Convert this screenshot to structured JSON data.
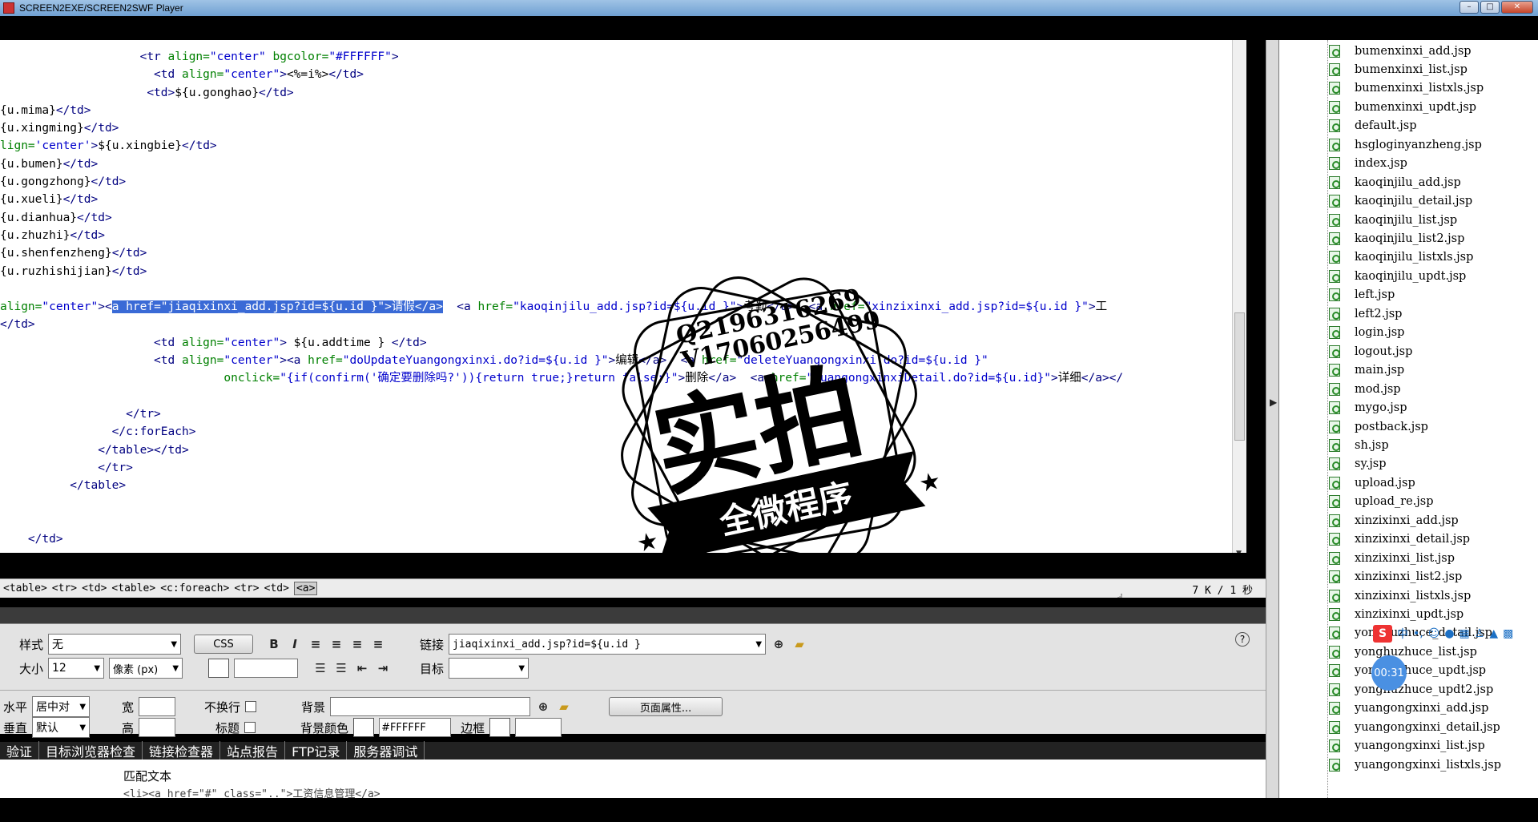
{
  "window": {
    "title": "SCREEN2EXE/SCREEN2SWF Player",
    "buttons": [
      "–",
      "□",
      "✕"
    ]
  },
  "code_lines": [
    [
      [
        "tag",
        "                    <tr "
      ],
      [
        "at",
        "align="
      ],
      [
        "str",
        "\"center\""
      ],
      [
        "at",
        " bgcolor="
      ],
      [
        "str",
        "\"#FFFFFF\""
      ],
      [
        "tag",
        ">"
      ]
    ],
    [
      [
        "tag",
        "                      <td "
      ],
      [
        "at",
        "align="
      ],
      [
        "str",
        "\"center\""
      ],
      [
        "tag",
        ">"
      ],
      [
        "tx",
        "<%=i%>"
      ],
      [
        "tag",
        "</td>"
      ]
    ],
    [
      [
        "tag",
        "                     <td>"
      ],
      [
        "tx",
        "${u.gonghao}"
      ],
      [
        "tag",
        "</td>"
      ]
    ],
    [
      [
        "tx",
        "{u.mima}"
      ],
      [
        "tag",
        "</td>"
      ]
    ],
    [
      [
        "tx",
        "{u.xingming}"
      ],
      [
        "tag",
        "</td>"
      ]
    ],
    [
      [
        "at",
        "lign="
      ],
      [
        "str",
        "'center'"
      ],
      [
        "tag",
        ">"
      ],
      [
        "tx",
        "${u.xingbie}"
      ],
      [
        "tag",
        "</td>"
      ]
    ],
    [
      [
        "tx",
        "{u.bumen}"
      ],
      [
        "tag",
        "</td>"
      ]
    ],
    [
      [
        "tx",
        "{u.gongzhong}"
      ],
      [
        "tag",
        "</td>"
      ]
    ],
    [
      [
        "tx",
        "{u.xueli}"
      ],
      [
        "tag",
        "</td>"
      ]
    ],
    [
      [
        "tx",
        "{u.dianhua}"
      ],
      [
        "tag",
        "</td>"
      ]
    ],
    [
      [
        "tx",
        "{u.zhuzhi}"
      ],
      [
        "tag",
        "</td>"
      ]
    ],
    [
      [
        "tx",
        "{u.shenfenzheng}"
      ],
      [
        "tag",
        "</td>"
      ]
    ],
    [
      [
        "tx",
        "{u.ruzhishijian}"
      ],
      [
        "tag",
        "</td>"
      ]
    ],
    [
      [
        "tx",
        ""
      ]
    ],
    [
      [
        "at",
        "align="
      ],
      [
        "str",
        "\"center\""
      ],
      [
        "tag",
        "><"
      ],
      [
        "sel",
        "a href=\"jiaqixinxi_add.jsp?id=${u.id }\">请假</a>"
      ],
      [
        "tx",
        "  "
      ],
      [
        "tag",
        "<a "
      ],
      [
        "at",
        "href="
      ],
      [
        "str",
        "\"kaoqinjilu_add.jsp?id=${u.id }\""
      ],
      [
        "tag",
        ">"
      ],
      [
        "tx",
        "考勤"
      ],
      [
        "tag",
        "</a>  <a "
      ],
      [
        "at",
        "href="
      ],
      [
        "str",
        "\"xinzixinxi_add.jsp?id=${u.id }\""
      ],
      [
        "tag",
        ">"
      ],
      [
        "tx",
        "工"
      ]
    ],
    [
      [
        "tag",
        "</td>"
      ]
    ],
    [
      [
        "tag",
        "                      <td "
      ],
      [
        "at",
        "align="
      ],
      [
        "str",
        "\"center\""
      ],
      [
        "tag",
        ">"
      ],
      [
        "tx",
        " ${u.addtime } "
      ],
      [
        "tag",
        "</td>"
      ]
    ],
    [
      [
        "tag",
        "                      <td "
      ],
      [
        "at",
        "align="
      ],
      [
        "str",
        "\"center\""
      ],
      [
        "tag",
        "><a "
      ],
      [
        "at",
        "href="
      ],
      [
        "str",
        "\"doUpdateYuangongxinxi.do?id=${u.id }\""
      ],
      [
        "tag",
        ">"
      ],
      [
        "tx",
        "编辑"
      ],
      [
        "tag",
        "</a>  <a "
      ],
      [
        "at",
        "href="
      ],
      [
        "str",
        "\"deleteYuangongxinxi.do?id=${u.id }\""
      ]
    ],
    [
      [
        "tx",
        "                                "
      ],
      [
        "at",
        "onclick="
      ],
      [
        "str",
        "\"{if(confirm('确定要删除吗?')){return true;}return false;}\""
      ],
      [
        "tag",
        ">"
      ],
      [
        "tx",
        "删除"
      ],
      [
        "tag",
        "</a>  <a "
      ],
      [
        "at",
        "href="
      ],
      [
        "str",
        "\"yuangongxinxiDetail.do?id=${u.id}\""
      ],
      [
        "tag",
        ">"
      ],
      [
        "tx",
        "详细"
      ],
      [
        "tag",
        "</a></"
      ]
    ],
    [
      [
        "tx",
        ""
      ]
    ],
    [
      [
        "tag",
        "                  </tr>"
      ]
    ],
    [
      [
        "tag",
        "                </c:forEach>"
      ]
    ],
    [
      [
        "tag",
        "              </table></td>"
      ]
    ],
    [
      [
        "tag",
        "              </tr>"
      ]
    ],
    [
      [
        "tag",
        "          </table>"
      ]
    ],
    [
      [
        "tx",
        ""
      ]
    ],
    [
      [
        "tx",
        ""
      ]
    ],
    [
      [
        "tag",
        "    </td>"
      ]
    ]
  ],
  "status": {
    "breadcrumbs": [
      "<table>",
      "<tr>",
      "<td>",
      "<table>",
      "<c:foreach>",
      "<tr>",
      "<td>",
      "<a>"
    ],
    "size": "7 K / 1 秒"
  },
  "props": {
    "style_label": "样式",
    "style_value": "无",
    "css_button": "CSS",
    "bold": "B",
    "italic": "I",
    "size_label": "大小",
    "size_value": "12",
    "unit_value": "像素 (px)",
    "link_label": "链接",
    "link_value": "jiaqixinxi_add.jsp?id=${u.id }",
    "target_label": "目标",
    "target_value": "",
    "halign_label": "水平",
    "halign_value": "居中对",
    "width_label": "宽",
    "nowrap_label": "不换行",
    "bg_label": "背景",
    "page_props_button": "页面属性...",
    "valign_label": "垂直",
    "valign_value": "默认",
    "height_label": "高",
    "header_label": "标题",
    "bgcolor_label": "背景颜色",
    "bgcolor_value": "#FFFFFF",
    "border_label": "边框",
    "help": "?"
  },
  "tabs": [
    "验证",
    "目标浏览器检查",
    "链接检查器",
    "站点报告",
    "FTP记录",
    "服务器调试"
  ],
  "results": {
    "header": "匹配文本",
    "line": "<li><a href=\"#\" class=\"..\">工资信息管理</a>"
  },
  "files": [
    "bumenxinxi_add.jsp",
    "bumenxinxi_list.jsp",
    "bumenxinxi_listxls.jsp",
    "bumenxinxi_updt.jsp",
    "default.jsp",
    "hsgloginyanzheng.jsp",
    "index.jsp",
    "kaoqinjilu_add.jsp",
    "kaoqinjilu_detail.jsp",
    "kaoqinjilu_list.jsp",
    "kaoqinjilu_list2.jsp",
    "kaoqinjilu_listxls.jsp",
    "kaoqinjilu_updt.jsp",
    "left.jsp",
    "left2.jsp",
    "login.jsp",
    "logout.jsp",
    "main.jsp",
    "mod.jsp",
    "mygo.jsp",
    "postback.jsp",
    "sh.jsp",
    "sy.jsp",
    "upload.jsp",
    "upload_re.jsp",
    "xinzixinxi_add.jsp",
    "xinzixinxi_detail.jsp",
    "xinzixinxi_list.jsp",
    "xinzixinxi_list2.jsp",
    "xinzixinxi_listxls.jsp",
    "xinzixinxi_updt.jsp",
    "yonghuzhuce_detail.jsp",
    "yonghuzhuce_list.jsp",
    "yonghuzhuce_updt.jsp",
    "yonghuzhuce_updt2.jsp",
    "yuangongxinxi_add.jsp",
    "yuangongxinxi_detail.jsp",
    "yuangongxinxi_list.jsp",
    "yuangongxinxi_listxls.jsp"
  ],
  "ime": {
    "logo": "S",
    "mode": "中"
  },
  "timer": "00:31",
  "watermark": {
    "line1": "Q2196316269",
    "line2": "V17060256499",
    "main": "实拍",
    "banner": "全微程序"
  }
}
